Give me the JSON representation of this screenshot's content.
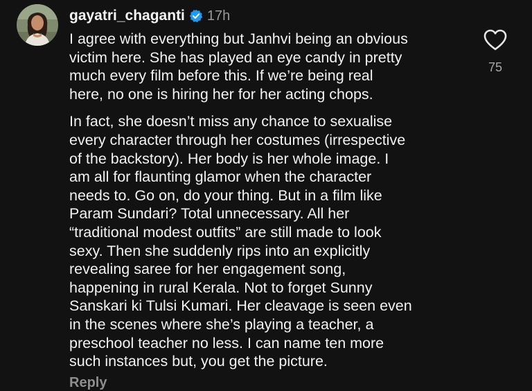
{
  "comment": {
    "username": "gayatri_chaganti",
    "timestamp": "17h",
    "verified": true,
    "paragraphs": [
      "I agree with everything but Janhvi being an obvious\nvictim here. She has played an eye candy in pretty\nmuch every film before this.  If we’re being real\nhere, no one is hiring her for her acting chops.",
      "In fact, she doesn’t miss any chance to sexualise\nevery character through her costumes (irrespective\nof the backstory). Her body is her whole image. I\nam all for flaunting glamor when the character\nneeds to. Go on, do your thing. But in a film like\nParam Sundari? Total unnecessary. All her\n“traditional modest outfits” are still made to look\nsexy. Then she suddenly rips into an explicitly\nrevealing saree for her engagement song,\nhappening in rural Kerala. Not to forget Sunny\nSanskari ki Tulsi Kumari. Her cleavage is seen even\nin the scenes where she’s playing a teacher, a\npreschool teacher no less. I can name ten more\nsuch instances but, you get the picture."
    ],
    "reply_label": "Reply",
    "like_count": "75"
  },
  "icons": {
    "verified": "verified-badge-icon",
    "like": "heart-outline-icon"
  },
  "colors": {
    "background": "#121212",
    "text": "#f2f2f2",
    "muted": "#9a9a9a",
    "verified": "#1d9bf0"
  }
}
